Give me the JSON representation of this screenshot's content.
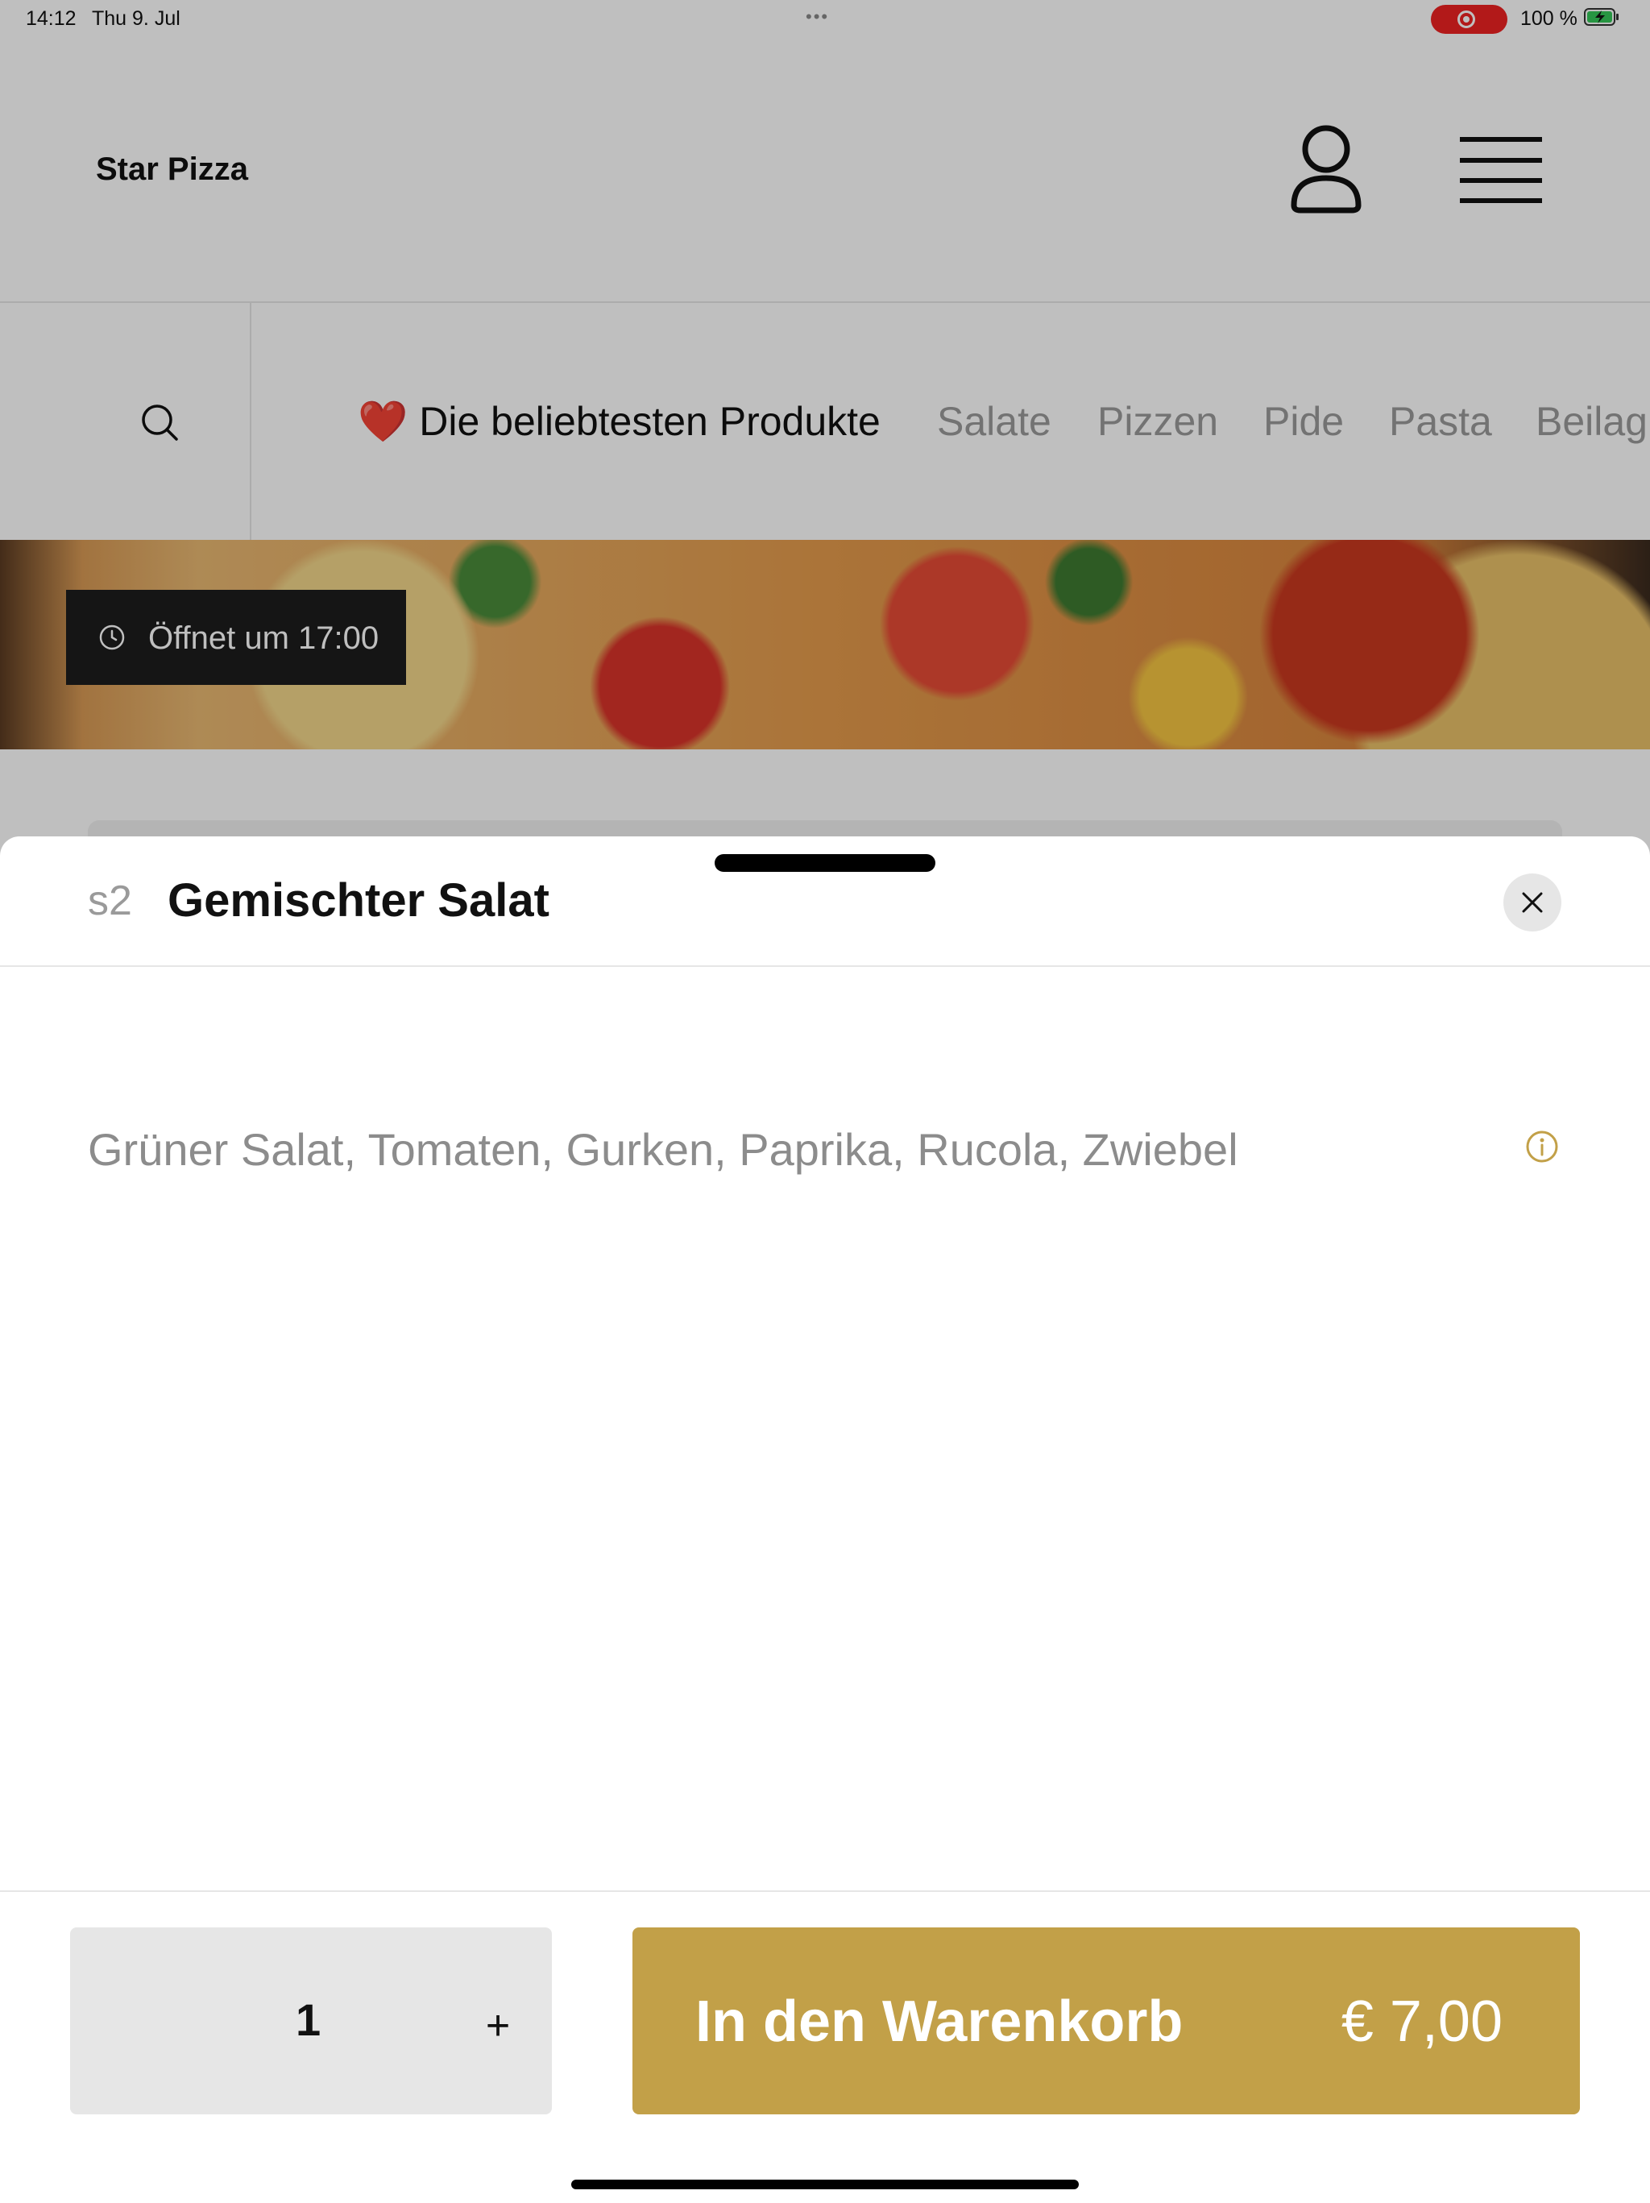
{
  "status_bar": {
    "time": "14:12",
    "date": "Thu 9. Jul",
    "battery_percent": "100 %"
  },
  "header": {
    "brand": "Star Pizza",
    "account_icon": "person-icon",
    "menu_icon": "hamburger-menu-icon"
  },
  "nav": {
    "search_icon": "search-icon",
    "categories": [
      {
        "label": "Die beliebtesten Produkte",
        "prefix": "❤️",
        "active": true
      },
      {
        "label": "Salate"
      },
      {
        "label": "Pizzen"
      },
      {
        "label": "Pide"
      },
      {
        "label": "Pasta"
      },
      {
        "label": "Beilag"
      }
    ]
  },
  "hero": {
    "status": "Öffnet um 17:00",
    "status_icon": "clock-icon"
  },
  "sheet": {
    "code": "s2",
    "title": "Gemischter Salat",
    "description": "Grüner Salat, Tomaten, Gurken, Paprika, Rucola, Zwiebel",
    "info_icon": "info-icon",
    "quantity": "1",
    "plus_label": "+",
    "add_to_cart_label": "In den Warenkorb",
    "price": "€ 7,00"
  },
  "colors": {
    "accent": "#c2a048",
    "recording": "#e22222",
    "muted_text": "#8c8c8c"
  }
}
